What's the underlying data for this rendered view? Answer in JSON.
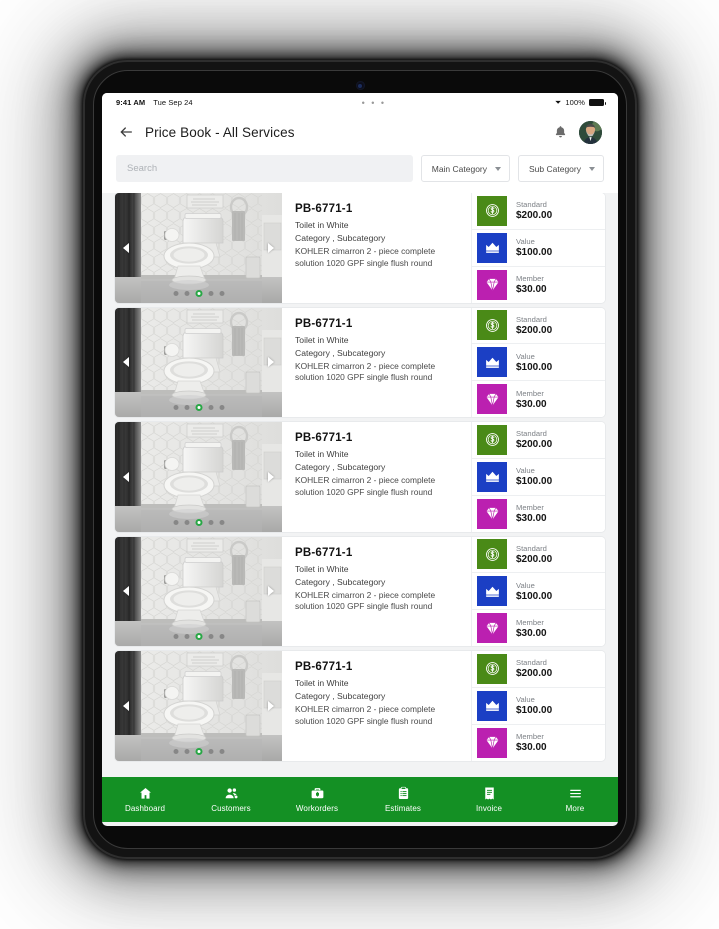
{
  "status_bar": {
    "time": "9:41 AM",
    "date": "Tue Sep 24",
    "center_dots": "• • •",
    "wifi_icon": "wifi-icon",
    "battery_percent": "100%",
    "battery_icon": "battery-icon"
  },
  "header": {
    "back_icon": "back-arrow-icon",
    "title": "Price Book - All Services",
    "bell_icon": "bell-icon",
    "avatar": "user-avatar"
  },
  "filters": {
    "search_placeholder": "Search",
    "search_value": "",
    "main_category_label": "Main Category",
    "sub_category_label": "Sub Category",
    "caret_icon": "chevron-down-icon"
  },
  "carousel": {
    "prev_icon": "chevron-left-icon",
    "next_icon": "chevron-right-icon",
    "dot_count": 5,
    "active_dot_index": 2
  },
  "tier_colors": {
    "standard": "#4a8a17",
    "value": "#1b3fc4",
    "member": "#bb20b0"
  },
  "products": [
    {
      "sku": "PB-6771-1",
      "name": "Toilet in White",
      "category": "Category , Subcategory",
      "description": "KOHLER cimarron 2 - piece complete solution 1020 GPF single flush round",
      "tiers": [
        {
          "label": "Standard",
          "price": "$200.00",
          "icon": "dollar-coin-icon",
          "color_key": "standard"
        },
        {
          "label": "Value",
          "price": "$100.00",
          "icon": "crown-icon",
          "color_key": "value"
        },
        {
          "label": "Member",
          "price": "$30.00",
          "icon": "diamond-icon",
          "color_key": "member"
        }
      ]
    },
    {
      "sku": "PB-6771-1",
      "name": "Toilet in White",
      "category": "Category , Subcategory",
      "description": "KOHLER cimarron 2 - piece complete solution 1020 GPF single flush round",
      "tiers": [
        {
          "label": "Standard",
          "price": "$200.00",
          "icon": "dollar-coin-icon",
          "color_key": "standard"
        },
        {
          "label": "Value",
          "price": "$100.00",
          "icon": "crown-icon",
          "color_key": "value"
        },
        {
          "label": "Member",
          "price": "$30.00",
          "icon": "diamond-icon",
          "color_key": "member"
        }
      ]
    },
    {
      "sku": "PB-6771-1",
      "name": "Toilet in White",
      "category": "Category , Subcategory",
      "description": "KOHLER cimarron 2 - piece complete solution 1020 GPF single flush round",
      "tiers": [
        {
          "label": "Standard",
          "price": "$200.00",
          "icon": "dollar-coin-icon",
          "color_key": "standard"
        },
        {
          "label": "Value",
          "price": "$100.00",
          "icon": "crown-icon",
          "color_key": "value"
        },
        {
          "label": "Member",
          "price": "$30.00",
          "icon": "diamond-icon",
          "color_key": "member"
        }
      ]
    },
    {
      "sku": "PB-6771-1",
      "name": "Toilet in White",
      "category": "Category , Subcategory",
      "description": "KOHLER cimarron 2 - piece complete solution 1020 GPF single flush round",
      "tiers": [
        {
          "label": "Standard",
          "price": "$200.00",
          "icon": "dollar-coin-icon",
          "color_key": "standard"
        },
        {
          "label": "Value",
          "price": "$100.00",
          "icon": "crown-icon",
          "color_key": "value"
        },
        {
          "label": "Member",
          "price": "$30.00",
          "icon": "diamond-icon",
          "color_key": "member"
        }
      ]
    },
    {
      "sku": "PB-6771-1",
      "name": "Toilet in White",
      "category": "Category , Subcategory",
      "description": "KOHLER cimarron 2 - piece complete solution 1020 GPF single flush round",
      "tiers": [
        {
          "label": "Standard",
          "price": "$200.00",
          "icon": "dollar-coin-icon",
          "color_key": "standard"
        },
        {
          "label": "Value",
          "price": "$100.00",
          "icon": "crown-icon",
          "color_key": "value"
        },
        {
          "label": "Member",
          "price": "$30.00",
          "icon": "diamond-icon",
          "color_key": "member"
        }
      ]
    }
  ],
  "bottom_nav": {
    "background": "#149024",
    "items": [
      {
        "label": "Dashboard",
        "icon": "home-icon"
      },
      {
        "label": "Customers",
        "icon": "people-icon"
      },
      {
        "label": "Workorders",
        "icon": "toolbox-icon"
      },
      {
        "label": "Estimates",
        "icon": "clipboard-icon"
      },
      {
        "label": "Invoice",
        "icon": "receipt-icon"
      },
      {
        "label": "More",
        "icon": "hamburger-menu-icon"
      }
    ]
  }
}
